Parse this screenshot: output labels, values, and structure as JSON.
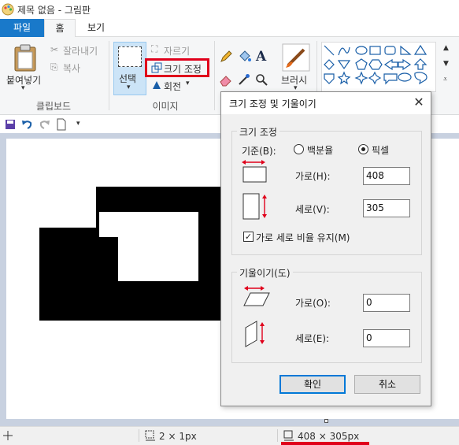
{
  "window": {
    "title": "제목 없음 - 그림판"
  },
  "tabs": [
    {
      "label": "파일"
    },
    {
      "label": "홈"
    },
    {
      "label": "보기"
    }
  ],
  "ribbon": {
    "clipboard": {
      "paste": "붙여넣기",
      "cut": "잘라내기",
      "copy": "복사",
      "group_label": "클립보드"
    },
    "image": {
      "select": "선택",
      "crop": "자르기",
      "resize": "크기 조정",
      "rotate": "회전",
      "group_label": "이미지"
    },
    "tools": {
      "brushes": "브러시"
    }
  },
  "dialog": {
    "title": "크기 조정 및 기울이기",
    "close_glyph": "✕",
    "resize_section": {
      "legend": "크기 조정",
      "basis_label": "기준(B):",
      "option_percent": "백분율",
      "option_pixel": "픽셀",
      "selected": "pixel",
      "horizontal_label": "가로(H):",
      "horizontal_value": "408",
      "vertical_label": "세로(V):",
      "vertical_value": "305",
      "keep_ratio_label": "가로 세로 비율 유지(M)",
      "keep_ratio_checked": true
    },
    "skew_section": {
      "legend": "기울이기(도)",
      "horizontal_label": "가로(O):",
      "horizontal_value": "0",
      "vertical_label": "세로(E):",
      "vertical_value": "0"
    },
    "ok_label": "확인",
    "cancel_label": "취소"
  },
  "statusbar": {
    "selection_size": "2 × 1px",
    "image_size": "408 × 305px"
  },
  "colors": {
    "file_tab": "#1979ca",
    "highlight": "#e0001b",
    "primary_border": "#0078d7"
  }
}
